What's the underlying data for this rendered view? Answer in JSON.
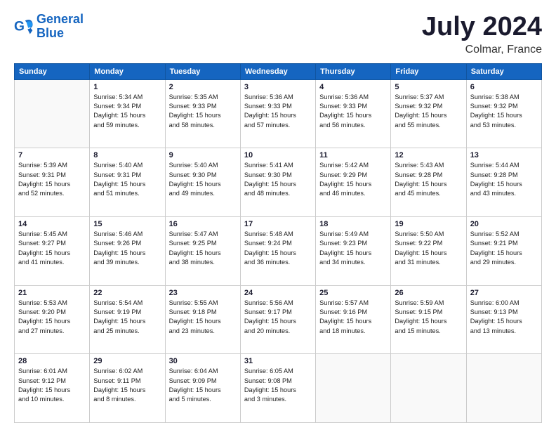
{
  "logo": {
    "line1": "General",
    "line2": "Blue"
  },
  "title": "July 2024",
  "subtitle": "Colmar, France",
  "days_of_week": [
    "Sunday",
    "Monday",
    "Tuesday",
    "Wednesday",
    "Thursday",
    "Friday",
    "Saturday"
  ],
  "weeks": [
    [
      {
        "day": "",
        "info": ""
      },
      {
        "day": "1",
        "info": "Sunrise: 5:34 AM\nSunset: 9:34 PM\nDaylight: 15 hours\nand 59 minutes."
      },
      {
        "day": "2",
        "info": "Sunrise: 5:35 AM\nSunset: 9:33 PM\nDaylight: 15 hours\nand 58 minutes."
      },
      {
        "day": "3",
        "info": "Sunrise: 5:36 AM\nSunset: 9:33 PM\nDaylight: 15 hours\nand 57 minutes."
      },
      {
        "day": "4",
        "info": "Sunrise: 5:36 AM\nSunset: 9:33 PM\nDaylight: 15 hours\nand 56 minutes."
      },
      {
        "day": "5",
        "info": "Sunrise: 5:37 AM\nSunset: 9:32 PM\nDaylight: 15 hours\nand 55 minutes."
      },
      {
        "day": "6",
        "info": "Sunrise: 5:38 AM\nSunset: 9:32 PM\nDaylight: 15 hours\nand 53 minutes."
      }
    ],
    [
      {
        "day": "7",
        "info": "Sunrise: 5:39 AM\nSunset: 9:31 PM\nDaylight: 15 hours\nand 52 minutes."
      },
      {
        "day": "8",
        "info": "Sunrise: 5:40 AM\nSunset: 9:31 PM\nDaylight: 15 hours\nand 51 minutes."
      },
      {
        "day": "9",
        "info": "Sunrise: 5:40 AM\nSunset: 9:30 PM\nDaylight: 15 hours\nand 49 minutes."
      },
      {
        "day": "10",
        "info": "Sunrise: 5:41 AM\nSunset: 9:30 PM\nDaylight: 15 hours\nand 48 minutes."
      },
      {
        "day": "11",
        "info": "Sunrise: 5:42 AM\nSunset: 9:29 PM\nDaylight: 15 hours\nand 46 minutes."
      },
      {
        "day": "12",
        "info": "Sunrise: 5:43 AM\nSunset: 9:28 PM\nDaylight: 15 hours\nand 45 minutes."
      },
      {
        "day": "13",
        "info": "Sunrise: 5:44 AM\nSunset: 9:28 PM\nDaylight: 15 hours\nand 43 minutes."
      }
    ],
    [
      {
        "day": "14",
        "info": "Sunrise: 5:45 AM\nSunset: 9:27 PM\nDaylight: 15 hours\nand 41 minutes."
      },
      {
        "day": "15",
        "info": "Sunrise: 5:46 AM\nSunset: 9:26 PM\nDaylight: 15 hours\nand 39 minutes."
      },
      {
        "day": "16",
        "info": "Sunrise: 5:47 AM\nSunset: 9:25 PM\nDaylight: 15 hours\nand 38 minutes."
      },
      {
        "day": "17",
        "info": "Sunrise: 5:48 AM\nSunset: 9:24 PM\nDaylight: 15 hours\nand 36 minutes."
      },
      {
        "day": "18",
        "info": "Sunrise: 5:49 AM\nSunset: 9:23 PM\nDaylight: 15 hours\nand 34 minutes."
      },
      {
        "day": "19",
        "info": "Sunrise: 5:50 AM\nSunset: 9:22 PM\nDaylight: 15 hours\nand 31 minutes."
      },
      {
        "day": "20",
        "info": "Sunrise: 5:52 AM\nSunset: 9:21 PM\nDaylight: 15 hours\nand 29 minutes."
      }
    ],
    [
      {
        "day": "21",
        "info": "Sunrise: 5:53 AM\nSunset: 9:20 PM\nDaylight: 15 hours\nand 27 minutes."
      },
      {
        "day": "22",
        "info": "Sunrise: 5:54 AM\nSunset: 9:19 PM\nDaylight: 15 hours\nand 25 minutes."
      },
      {
        "day": "23",
        "info": "Sunrise: 5:55 AM\nSunset: 9:18 PM\nDaylight: 15 hours\nand 23 minutes."
      },
      {
        "day": "24",
        "info": "Sunrise: 5:56 AM\nSunset: 9:17 PM\nDaylight: 15 hours\nand 20 minutes."
      },
      {
        "day": "25",
        "info": "Sunrise: 5:57 AM\nSunset: 9:16 PM\nDaylight: 15 hours\nand 18 minutes."
      },
      {
        "day": "26",
        "info": "Sunrise: 5:59 AM\nSunset: 9:15 PM\nDaylight: 15 hours\nand 15 minutes."
      },
      {
        "day": "27",
        "info": "Sunrise: 6:00 AM\nSunset: 9:13 PM\nDaylight: 15 hours\nand 13 minutes."
      }
    ],
    [
      {
        "day": "28",
        "info": "Sunrise: 6:01 AM\nSunset: 9:12 PM\nDaylight: 15 hours\nand 10 minutes."
      },
      {
        "day": "29",
        "info": "Sunrise: 6:02 AM\nSunset: 9:11 PM\nDaylight: 15 hours\nand 8 minutes."
      },
      {
        "day": "30",
        "info": "Sunrise: 6:04 AM\nSunset: 9:09 PM\nDaylight: 15 hours\nand 5 minutes."
      },
      {
        "day": "31",
        "info": "Sunrise: 6:05 AM\nSunset: 9:08 PM\nDaylight: 15 hours\nand 3 minutes."
      },
      {
        "day": "",
        "info": ""
      },
      {
        "day": "",
        "info": ""
      },
      {
        "day": "",
        "info": ""
      }
    ]
  ]
}
